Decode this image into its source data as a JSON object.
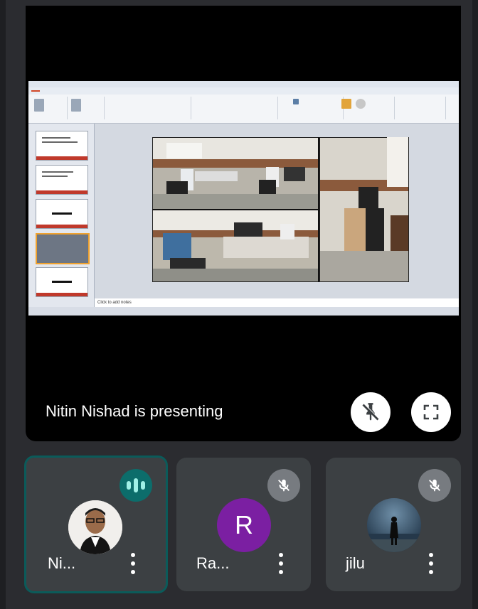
{
  "presentation": {
    "status_text": "Nitin Nishad is presenting",
    "ppt_notes_placeholder": "Click to add notes"
  },
  "participants": [
    {
      "name": "Ni...",
      "avatar": "photo",
      "state": "speaking"
    },
    {
      "name": "Ra...",
      "avatar_letter": "R",
      "avatar_color": "#7b1fa2",
      "state": "muted"
    },
    {
      "name": "jilu",
      "avatar": "photo",
      "state": "muted"
    }
  ],
  "colors": {
    "stage_background": "#000000",
    "tile_background": "#3c4043",
    "active_speaker_border": "#0b5b5a",
    "speaking_indicator": "#0c6d6b",
    "muted_indicator": "#777b80"
  }
}
